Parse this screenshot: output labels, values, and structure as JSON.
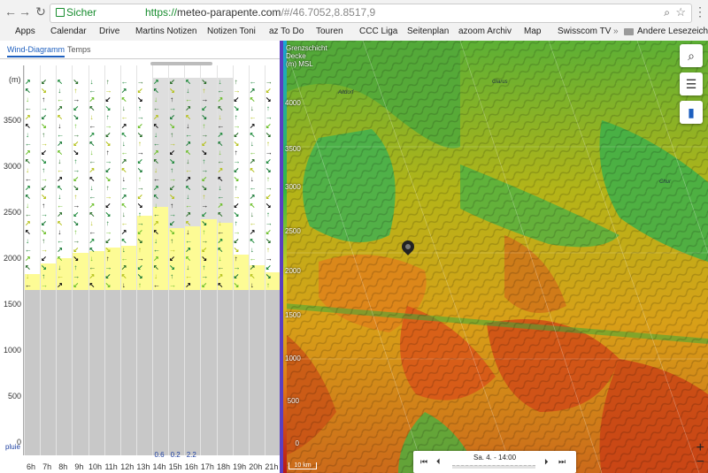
{
  "browser": {
    "secure_label": "Sicher",
    "url_scheme": "https://",
    "url_host": "meteo-parapente.com",
    "url_path": "/#/46.7052,8.8517,9"
  },
  "bookmarks": [
    {
      "label": "Apps",
      "color": "#6a6a6a"
    },
    {
      "label": "Calendar",
      "color": "#3d7de0"
    },
    {
      "label": "Drive",
      "color": "#f4b400"
    },
    {
      "label": "Martins Notizen",
      "color": "#3d6bc8"
    },
    {
      "label": "Notizen Toni",
      "color": "#3d6bc8"
    },
    {
      "label": "az To Do",
      "color": "#3d6bc8"
    },
    {
      "label": "Touren",
      "color": "#3d6bc8"
    },
    {
      "label": "CCC Liga",
      "color": "#3d6bc8"
    },
    {
      "label": "Seitenplan",
      "color": "#222222"
    },
    {
      "label": "azoom Archiv",
      "color": "#8ac045"
    },
    {
      "label": "Map",
      "color": "#d0021b"
    },
    {
      "label": "Swisscom TV",
      "color": "#e4004b"
    },
    {
      "label": "Andere Lesezeichen",
      "color": "#9a9a9a"
    }
  ],
  "panel": {
    "tabs": [
      "Wind-Diagramm",
      "Temps"
    ],
    "unit": "(m)",
    "y_ticks": [
      "3500",
      "3000",
      "2500",
      "2000",
      "1500",
      "1000",
      "500",
      "0"
    ],
    "pluie_label": "pluie",
    "hours": [
      "6h",
      "7h",
      "8h",
      "9h",
      "10h",
      "11h",
      "12h",
      "13h",
      "14h",
      "15h",
      "16h",
      "17h",
      "18h",
      "19h",
      "20h",
      "21h"
    ],
    "rain": [
      "",
      "",
      "",
      "",
      "",
      "",
      "",
      "",
      "0.6",
      "0.2",
      "2.2",
      "",
      "",
      "",
      "",
      ""
    ]
  },
  "map": {
    "title_line1": "Grenzschicht",
    "title_line2": "Decke",
    "title_line3": "(m) MSL",
    "scale": [
      "4000",
      "3500",
      "3000",
      "2500",
      "2000",
      "1500",
      "1000",
      "500",
      "0"
    ],
    "places": [
      "Altdorf",
      "Glarus",
      "Chur"
    ],
    "km_label": "10 km",
    "time_label": "Sa. 4. - 14:00",
    "zoom_in": "+",
    "zoom_out": "−"
  },
  "colors": {
    "accent": "#1d5fbf",
    "divider": "#5b3fc0",
    "convergence": "#fdfb95"
  }
}
